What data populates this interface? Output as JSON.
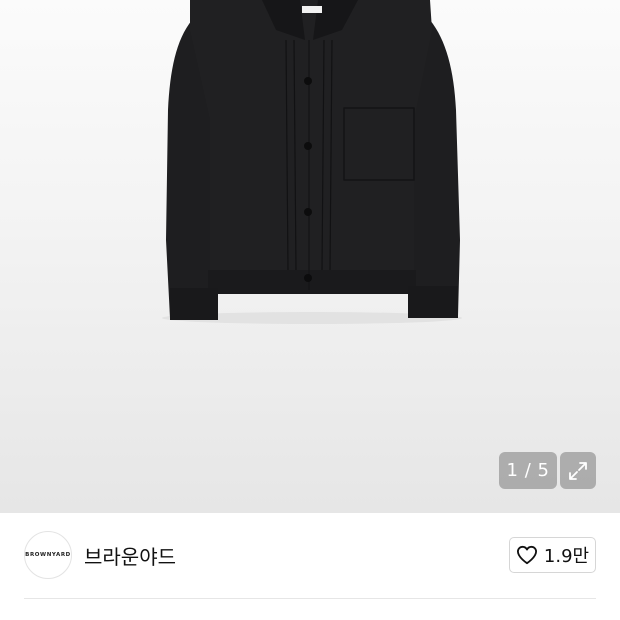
{
  "gallery": {
    "current": "1",
    "total": "5",
    "separator": " / ",
    "expand_icon": "expand-icon"
  },
  "brand": {
    "logo_text": "BROWNYARD",
    "name": "브라운야드"
  },
  "like": {
    "icon": "heart-icon",
    "count": "1.9만"
  },
  "colors": {
    "jacket": "#1c1c1e",
    "overlay": "#969696",
    "border": "#d6d6d6"
  }
}
